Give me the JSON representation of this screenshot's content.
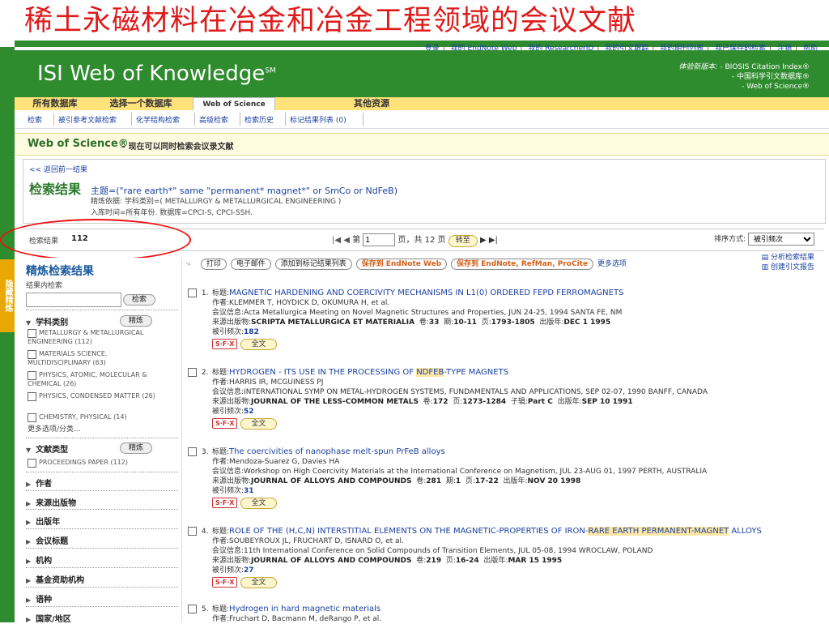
{
  "slide_title": "稀土永磁材料在冶金和冶金工程领域的会议文献",
  "top_links": [
    "登录",
    "我的 EndNote Web",
    "我的 ResearcherID",
    "我的引文跟踪",
    "我的期刊列表",
    "我已保存的检索",
    "注销",
    "帮助"
  ],
  "logo": {
    "text": "ISI Web of Knowledge",
    "mark": "SM"
  },
  "edition": {
    "label": "体验新版本: - ",
    "lines": [
      "BIOSIS Citation Index®",
      "- 中国科学引文数据库®",
      "- Web of Science®"
    ]
  },
  "tabs": {
    "all_db": "所有数据库",
    "select_db": "选择一个数据库",
    "active": "Web of Science",
    "other": "其他资源"
  },
  "subnav": [
    "检索",
    "被引参考文献检索",
    "化学结构检索",
    "高级检索",
    "检索历史",
    "标记结果列表 (0)"
  ],
  "wos": {
    "title": "Web of Science®",
    "subtitle": "– 现在可以同时检索会议录文献"
  },
  "search": {
    "back": "<< 返回前一结果",
    "heading": "检索结果",
    "query_prefix": "主题=(\"rare earth*\" same \"permanent* magnet*\" or SmCo or NdFeB)",
    "refine": "精炼依据: 学科类别=( METALLURGY & METALLURGICAL ENGINEERING )",
    "time": "入库时间=所有年份. 数据库=CPCI-S, CPCI-SSH."
  },
  "results": {
    "label": "检索结果",
    "count": "112"
  },
  "pager": {
    "first_prev": "|◀ ◀",
    "page_label": "第",
    "page_value": "1",
    "of": "页，共 12 页",
    "go": "转至",
    "next_last": "▶ ▶|"
  },
  "sort": {
    "label": "排序方式:",
    "value": "被引频次"
  },
  "side_tab": "隐藏精炼",
  "sidebar": {
    "heading": "精炼检索结果",
    "within": "结果内检索",
    "search_btn": "检索",
    "refine_btn": "精炼",
    "subject_heading": "学科类别",
    "subjects": [
      "METALLURGY & METALLURGICAL ENGINEERING (112)",
      "MATERIALS SCIENCE, MULTIDISCIPLINARY (63)",
      "PHYSICS, ATOMIC, MOLECULAR & CHEMICAL (26)",
      "PHYSICS, CONDENSED MATTER (26)",
      "CHEMISTRY, PHYSICAL (14)"
    ],
    "more": "更多选项/分类...",
    "doctype_heading": "文献类型",
    "doctypes": [
      "PROCEEDINGS PAPER (112)"
    ],
    "facets": [
      "作者",
      "来源出版物",
      "出版年",
      "会议标题",
      "机构",
      "基金资助机构",
      "语种",
      "国家/地区"
    ]
  },
  "toolbar": {
    "print": "打印",
    "email": "电子邮件",
    "mark": "添加到标记结果列表",
    "save_endnote_web": "保存到 EndNote Web",
    "save_endnote": "保存到 EndNote, RefMan, ProCite",
    "more": "更多选项",
    "analyze": "分析检索结果",
    "citation_report": "创建引文报告"
  },
  "labels": {
    "title": "标题:",
    "author": "作者:",
    "conference": "会议信息:",
    "source": "来源出版物:",
    "volume": "卷:",
    "issue": "期:",
    "pages": "页:",
    "year": "出版年:",
    "cited": "被引频次:",
    "fulltext": "全文",
    "sfx": "S·F·X",
    "supplement": "子辑:"
  },
  "records": [
    {
      "num": "1.",
      "title": "MAGNETIC HARDENING AND COERCIVITY MECHANISMS IN L1(0) ORDERED FEPD FERROMAGNETS",
      "authors": "KLEMMER T, HOYDICK D, OKUMURA H, et al.",
      "conference": "Acta Metallurgica Meeting on Novel Magnetic Structures and Properties, JUN 24-25, 1994 SANTA FE, NM",
      "source": "SCRIPTA METALLURGICA ET MATERIALIA",
      "volume": "33",
      "issue": "10-11",
      "pages": "1793-1805",
      "year": "DEC 1 1995",
      "cited": "182"
    },
    {
      "num": "2.",
      "title_pre": "HYDROGEN - ITS USE IN THE PROCESSING OF ",
      "title_hl": "NDFEB",
      "title_post": "-TYPE MAGNETS",
      "authors": "HARRIS IR, MCGUINESS PJ",
      "conference": "INTERNATIONAL SYMP ON METAL-HYDROGEN SYSTEMS, FUNDAMENTALS AND APPLICATIONS, SEP 02-07, 1990 BANFF, CANADA",
      "source": "JOURNAL OF THE LESS-COMMON METALS",
      "volume": "172",
      "pages": "1273-1284",
      "supplement": "Part C",
      "year": "SEP 10 1991",
      "cited": "52"
    },
    {
      "num": "3.",
      "title": "The coercivities of nanophase melt-spun PrFeB alloys",
      "authors": "Mendoza-Suarez G, Davies HA",
      "conference": "Workshop on High Coercivity Materials at the International Conference on Magnetism, JUL 23-AUG 01, 1997 PERTH, AUSTRALIA",
      "source": "JOURNAL OF ALLOYS AND COMPOUNDS",
      "volume": "281",
      "issue": "1",
      "pages": "17-22",
      "year": "NOV 20 1998",
      "cited": "31"
    },
    {
      "num": "4.",
      "title_pre": "ROLE OF THE (H,C,N) INTERSTITIAL ELEMENTS ON THE MAGNETIC-PROPERTIES OF IRON-",
      "title_hl": "RARE EARTH PERMANENT-MAGNET",
      "title_post": " ALLOYS",
      "authors": "SOUBEYROUX JL, FRUCHART D, ISNARD O, et al.",
      "conference": "11th International Conference on Solid Compounds of Transition Elements, JUL 05-08, 1994 WROCLAW, POLAND",
      "source": "JOURNAL OF ALLOYS AND COMPOUNDS",
      "volume": "219",
      "pages": "16-24",
      "year": "MAR 15 1995",
      "cited": "27"
    },
    {
      "num": "5.",
      "title": "Hydrogen in hard magnetic materials",
      "authors": "Fruchart D, Bacmann M, deRango P, et al."
    }
  ]
}
